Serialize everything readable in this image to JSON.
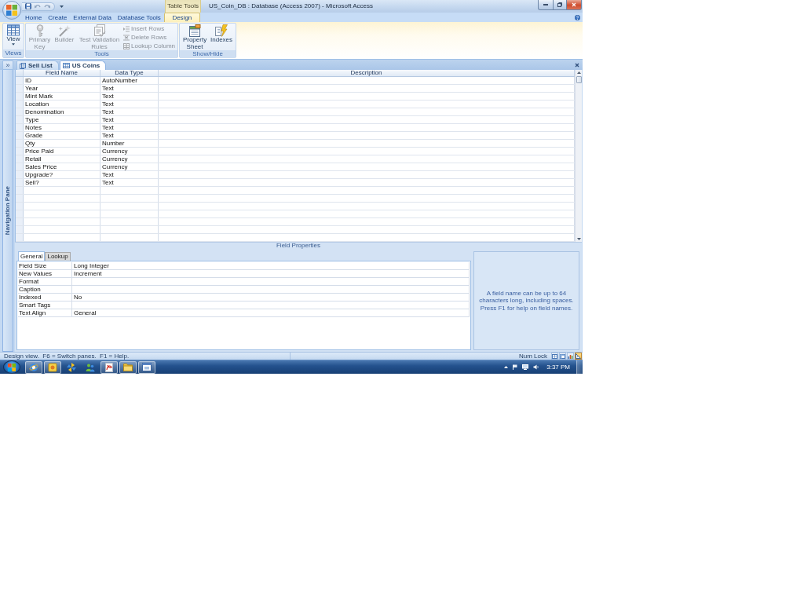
{
  "window": {
    "title": "US_Coin_DB : Database (Access 2007) - Microsoft Access",
    "contextual_group": "Table Tools"
  },
  "ribbon": {
    "tabs": [
      {
        "label": "Home",
        "selected": false
      },
      {
        "label": "Create",
        "selected": false
      },
      {
        "label": "External Data",
        "selected": false
      },
      {
        "label": "Database Tools",
        "selected": false
      },
      {
        "label": "Design",
        "selected": true,
        "contextual": true
      }
    ],
    "groups": [
      {
        "label": "Views",
        "commands": [
          {
            "kind": "large",
            "label": "View",
            "disabled": false,
            "dropdown": true
          }
        ]
      },
      {
        "label": "Tools",
        "commands": [
          {
            "kind": "large",
            "label": "Primary Key",
            "disabled": true
          },
          {
            "kind": "large",
            "label": "Builder",
            "disabled": true
          },
          {
            "kind": "large",
            "label": "Test Validation Rules",
            "disabled": true
          },
          {
            "kind": "small",
            "label": "Insert Rows",
            "disabled": true
          },
          {
            "kind": "small",
            "label": "Delete Rows",
            "disabled": true
          },
          {
            "kind": "small",
            "label": "Lookup Column",
            "disabled": true
          }
        ]
      },
      {
        "label": "Show/Hide",
        "commands": [
          {
            "kind": "large",
            "label": "Property Sheet",
            "disabled": false
          },
          {
            "kind": "large",
            "label": "Indexes",
            "disabled": false
          }
        ]
      }
    ]
  },
  "document_tabs": [
    {
      "label": "Sell List",
      "kind": "query",
      "selected": false
    },
    {
      "label": "US Coins",
      "kind": "table",
      "selected": true
    }
  ],
  "navigation_pane": {
    "title": "Navigation Pane",
    "toggle": "»"
  },
  "design_grid": {
    "columns": [
      "Field Name",
      "Data Type",
      "Description"
    ],
    "rows": [
      {
        "field_name": "ID",
        "data_type": "AutoNumber"
      },
      {
        "field_name": "Year",
        "data_type": "Text"
      },
      {
        "field_name": "Mint Mark",
        "data_type": "Text"
      },
      {
        "field_name": "Location",
        "data_type": "Text"
      },
      {
        "field_name": "Denomination",
        "data_type": "Text"
      },
      {
        "field_name": "Type",
        "data_type": "Text"
      },
      {
        "field_name": "Notes",
        "data_type": "Text"
      },
      {
        "field_name": "Grade",
        "data_type": "Text"
      },
      {
        "field_name": "Qty",
        "data_type": "Number"
      },
      {
        "field_name": "Price Paid",
        "data_type": "Currency"
      },
      {
        "field_name": "Retail",
        "data_type": "Currency"
      },
      {
        "field_name": "Sales Price",
        "data_type": "Currency"
      },
      {
        "field_name": "Upgrade?",
        "data_type": "Text"
      },
      {
        "field_name": "Sell?",
        "data_type": "Text"
      }
    ]
  },
  "field_properties": {
    "title": "Field Properties",
    "tabs": [
      {
        "label": "General",
        "selected": true
      },
      {
        "label": "Lookup",
        "selected": false
      }
    ],
    "properties": [
      {
        "name": "Field Size",
        "value": "Long Integer"
      },
      {
        "name": "New Values",
        "value": "Increment"
      },
      {
        "name": "Format"
      },
      {
        "name": "Caption"
      },
      {
        "name": "Indexed",
        "value": "No"
      },
      {
        "name": "Smart Tags"
      },
      {
        "name": "Text Align",
        "value": "General"
      }
    ],
    "help_text": "A field name can be up to 64 characters long, including spaces. Press F1 for help on field names."
  },
  "status_bar": {
    "text": "Design view.  F6 = Switch panes.  F1 = Help.",
    "indicator": "Num Lock",
    "views": [
      {
        "kind": "datasheet",
        "selected": false
      },
      {
        "kind": "pivot_table",
        "selected": false
      },
      {
        "kind": "pivot_chart",
        "selected": false
      },
      {
        "kind": "design",
        "selected": true
      }
    ]
  },
  "taskbar": {
    "apps": [
      {
        "kind": "browser",
        "running": true
      },
      {
        "kind": "notes",
        "running": true
      },
      {
        "kind": "pinwheel",
        "running": false
      },
      {
        "kind": "people",
        "running": false
      },
      {
        "kind": "document",
        "running": true
      },
      {
        "kind": "folder",
        "running": true
      },
      {
        "kind": "window",
        "running": true
      }
    ],
    "clock": "3:37 PM"
  }
}
